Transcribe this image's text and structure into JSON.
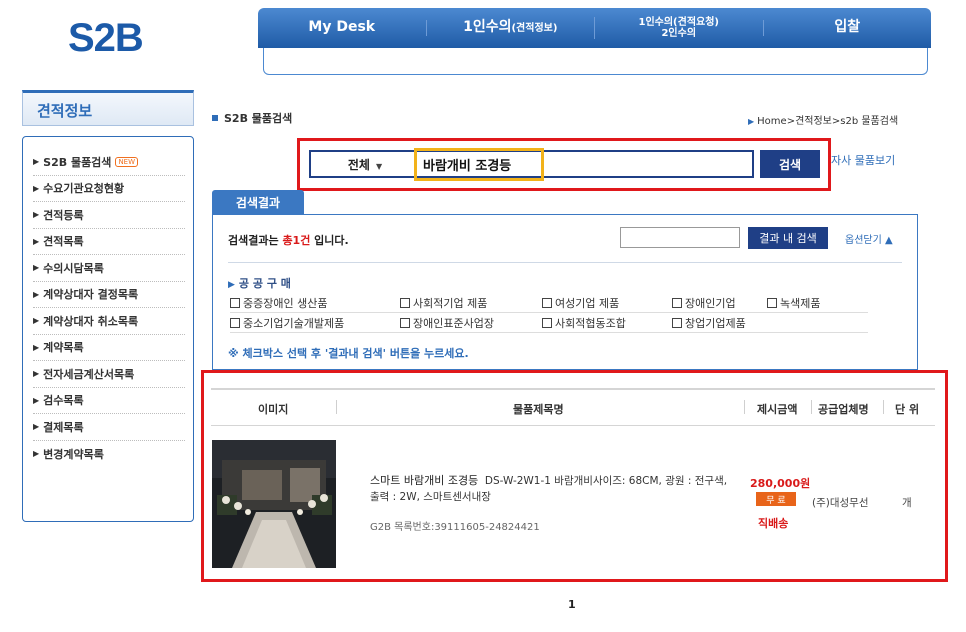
{
  "logo": "S2B",
  "topnav": {
    "items": [
      {
        "label": "My Desk"
      },
      {
        "label": "1인수의",
        "small": "(견적정보)"
      },
      {
        "line1": "1인수의(견적요청)",
        "line2": "2인수의"
      },
      {
        "label": "입찰"
      }
    ]
  },
  "sidebar": {
    "title": "견적정보",
    "items": [
      {
        "label": "S2B 물품검색",
        "badge": "NEW"
      },
      {
        "label": "수요기관요청현황"
      },
      {
        "label": "견적등록"
      },
      {
        "label": "견적목록"
      },
      {
        "label": "수의시담목록"
      },
      {
        "label": "계약상대자 결정목록"
      },
      {
        "label": "계약상대자 취소목록"
      },
      {
        "label": "계약목록"
      },
      {
        "label": "전자세금계산서목록"
      },
      {
        "label": "검수목록"
      },
      {
        "label": "결제목록"
      },
      {
        "label": "변경계약목록"
      }
    ]
  },
  "page": {
    "title": "S2B 물품검색",
    "breadcrumb": "Home>견적정보>s2b 물품검색"
  },
  "search": {
    "category": "전체",
    "query": "바람개비 조경등",
    "button": "검색",
    "own_link": "자사 물품보기"
  },
  "results": {
    "tab": "검색결과",
    "count_prefix": "검색결과는 ",
    "count_total": "총1건",
    "count_suffix": " 입니다.",
    "inner_search_button": "결과 내 검색",
    "close_options": "옵션닫기",
    "public_title": "공 공 구 매",
    "checkboxes_row1": [
      "중증장애인 생산품",
      "사회적기업 제품",
      "여성기업 제품",
      "장애인기업",
      "녹색제품"
    ],
    "checkboxes_row2": [
      "중소기업기술개발제품",
      "장애인표준사업장",
      "사회적협동조합",
      "창업기업제품"
    ],
    "notice": "※ 체크박스 선택 후 '결과내 검색' 버튼을 누르세요."
  },
  "list": {
    "headers": {
      "image": "이미지",
      "name": "물품제목명",
      "price": "제시금액",
      "supplier": "공급업체명",
      "unit": "단 위"
    },
    "items": [
      {
        "name": "스마트 바람개비 조경등",
        "spec": "DS-W-2W1-1 바람개비사이즈: 68CM, 광원 : 전구색, 출력 : 2W, 스마트센서내장",
        "reg_no": "G2B 목록번호:39111605-24824421",
        "price": "280,000원",
        "shipping": "무 료",
        "delivery": "직배송",
        "supplier": "(주)대성무선",
        "unit": "개"
      }
    ]
  },
  "pager": {
    "current": "1"
  },
  "colors": {
    "brand": "#1c5aa8",
    "accent_red": "#e0181b",
    "highlight_yellow": "#f2b21a"
  }
}
